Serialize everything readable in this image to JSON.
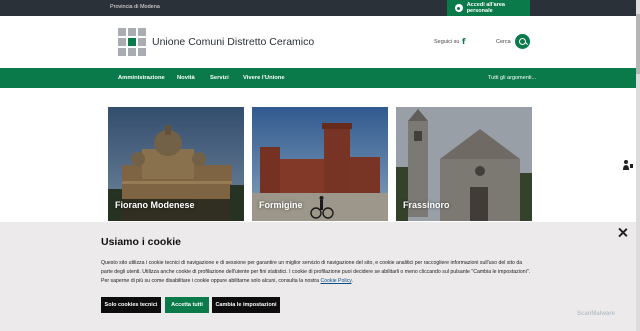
{
  "topbar": {
    "region": "Provincia di Modena",
    "login_label": "Accedi all'area personale"
  },
  "header": {
    "site_name": "Unione Comuni Distretto Ceramico",
    "follow_label": "Seguici su",
    "facebook_glyph": "f",
    "search_label": "Cerca"
  },
  "nav": {
    "items": [
      "Amministrazione",
      "Novità",
      "Servizi",
      "Vivere l'Unione"
    ],
    "all_topics": "Tutti gli argomenti..."
  },
  "cards": [
    {
      "name": "Fiorano Modenese"
    },
    {
      "name": "Formigine"
    },
    {
      "name": "Frassinoro"
    }
  ],
  "cookie": {
    "title": "Usiamo i cookie",
    "text": "Questo sito utilizza i cookie tecnici di navigazione e di sessione per garantire un miglior servizio di navigazione del sito, e cookie analitici per raccogliere informazioni sull'uso del sito da parte degli utenti. Utilizza anche cookie di profilazione dell'utente per fini statistici. I cookie di profilazione puoi decidere se abilitarli o meno cliccando sul pulsante \"Cambia le impostazioni\". Per saperne di più su come disabilitare i cookie oppure abilitarne solo alcuni, consulta la nostra ",
    "policy_link": "Cookie Policy",
    "policy_end": ".",
    "btn_technical": "Solo cookies tecnici",
    "btn_accept": "Accetta tutti",
    "btn_settings": "Cambia le impostazioni"
  },
  "watermark": "ScanMalware",
  "colors": {
    "brand_green": "#0a7a4b",
    "topbar_dark": "#2b3138",
    "banner_bg": "#eceaea"
  }
}
